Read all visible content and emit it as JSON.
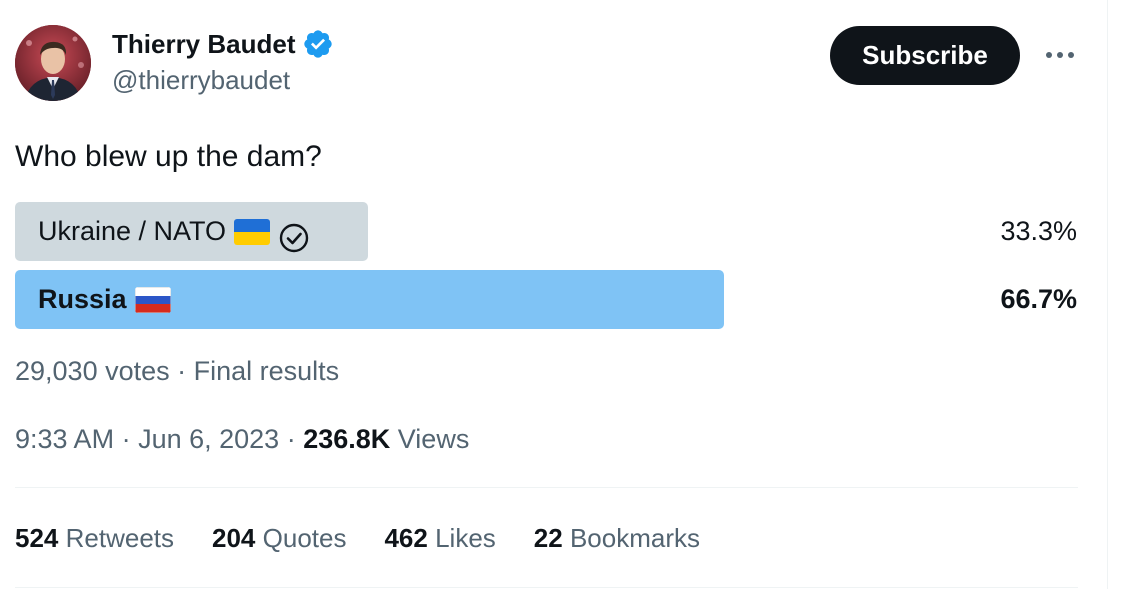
{
  "author": {
    "display_name": "Thierry Baudet",
    "handle": "@thierrybaudet",
    "avatar_icon": "user-avatar",
    "verified_icon": "verified-badge-icon",
    "verified_color": "#1d9bf0"
  },
  "header": {
    "subscribe_label": "Subscribe",
    "more_icon": "more-horizontal-icon"
  },
  "tweet": {
    "text": "Who blew up the dam?"
  },
  "poll": {
    "options": [
      {
        "label": "Ukraine / NATO",
        "flag": "ukraine-flag",
        "selected": true,
        "percent_text": "33.3%",
        "percent": 33.3,
        "bar_color": "#cfd9de"
      },
      {
        "label": "Russia",
        "flag": "russia-flag",
        "selected": false,
        "winner": true,
        "percent_text": "66.7%",
        "percent": 66.7,
        "bar_color": "#7fc3f5"
      }
    ],
    "votes_text": "29,030 votes",
    "separator": " · ",
    "status_text": "Final results"
  },
  "meta": {
    "time": "9:33 AM",
    "date": "Jun 6, 2023",
    "separator": " · ",
    "views_count": "236.8K",
    "views_label": "Views"
  },
  "stats": {
    "retweets_count": "524",
    "retweets_label": "Retweets",
    "quotes_count": "204",
    "quotes_label": "Quotes",
    "likes_count": "462",
    "likes_label": "Likes",
    "bookmarks_count": "22",
    "bookmarks_label": "Bookmarks"
  },
  "colors": {
    "text_primary": "#0f1419",
    "text_secondary": "#536471",
    "button_bg": "#0f1419",
    "divider": "#eff3f4"
  }
}
